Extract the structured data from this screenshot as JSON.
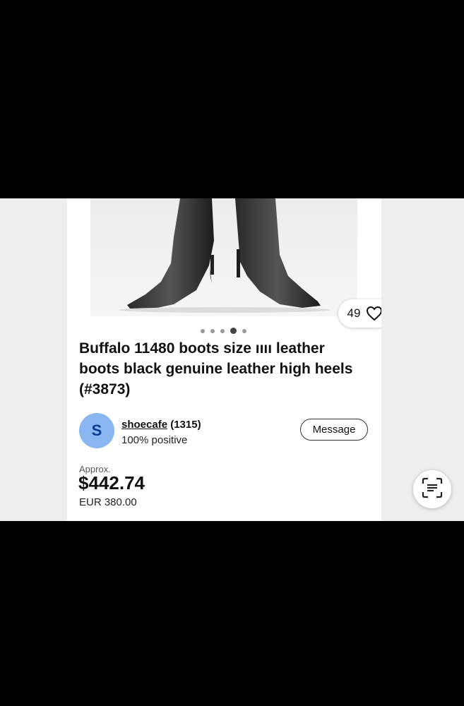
{
  "listing": {
    "like_count": "49",
    "carousel": {
      "total": 5,
      "active_index": 3
    },
    "title": "Buffalo 11480 boots size ıııı leather boots black genuine leather high heels (#3873)"
  },
  "seller": {
    "avatar_letter": "S",
    "name": "shoecafe",
    "feedback_count": "(1315)",
    "positive": "100% positive",
    "message_label": "Message"
  },
  "price": {
    "approx_label": "Approx.",
    "usd": "$442.74",
    "original": "EUR 380.00"
  },
  "icons": {
    "like": "heart-icon",
    "scan": "visual-search-icon"
  }
}
